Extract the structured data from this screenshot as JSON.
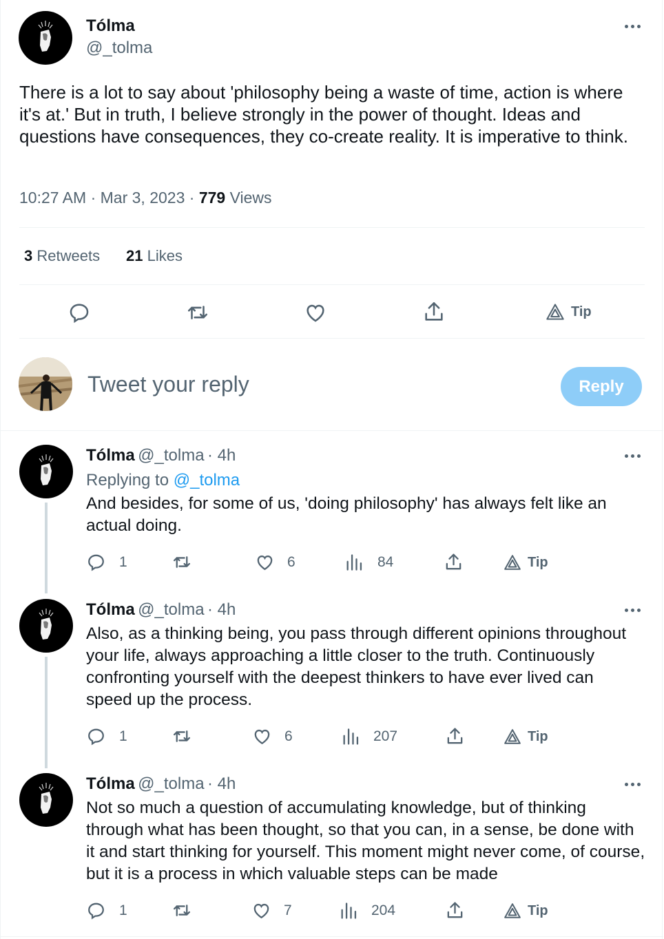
{
  "main_tweet": {
    "author_name": "Tólma",
    "author_handle": "@_tolma",
    "text": "There is a lot to say about 'philosophy being  a waste of time, action is where it's at.' But in truth, I believe strongly in the power of thought. Ideas and questions have consequences, they co-create reality. It is imperative to think.",
    "time": "10:27 AM",
    "date": "Mar 3, 2023",
    "views_count": "779",
    "views_label": "Views",
    "separator": "·",
    "retweets_count": "3",
    "retweets_label": "Retweets",
    "likes_count": "21",
    "likes_label": "Likes",
    "tip_label": "Tip"
  },
  "composer": {
    "placeholder": "Tweet your reply",
    "reply_button": "Reply"
  },
  "replies": [
    {
      "author_name": "Tólma",
      "author_handle": "@_tolma",
      "age": "· 4h",
      "replying_prefix": "Replying to",
      "replying_to": "@_tolma",
      "text": "And besides, for some of us, 'doing philosophy' has always felt like an actual doing.",
      "reply_count": "1",
      "like_count": "6",
      "view_count": "84",
      "tip_label": "Tip"
    },
    {
      "author_name": "Tólma",
      "author_handle": "@_tolma",
      "age": "· 4h",
      "text": "Also, as a thinking being, you pass through different opinions throughout your life, always approaching a little closer to the truth. Continuously confronting yourself with the deepest thinkers to have ever lived can speed up the process.",
      "reply_count": "1",
      "like_count": "6",
      "view_count": "207",
      "tip_label": "Tip"
    },
    {
      "author_name": "Tólma",
      "author_handle": "@_tolma",
      "age": "· 4h",
      "text": "Not so much a question of accumulating knowledge, but of thinking through what has been thought, so that you can, in a sense, be done with it and start thinking for yourself. This moment might never come, of course, but it is a process in which valuable steps can be made",
      "reply_count": "1",
      "like_count": "7",
      "view_count": "204",
      "tip_label": "Tip"
    }
  ],
  "colors": {
    "text_primary": "#0f1419",
    "text_secondary": "#536471",
    "link": "#1d9bf0",
    "reply_button_disabled": "#8ecdf8",
    "divider": "#eff3f4"
  }
}
